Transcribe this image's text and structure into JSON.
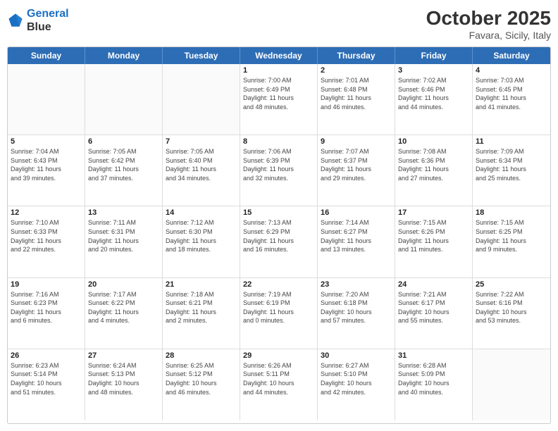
{
  "header": {
    "logo_line1": "General",
    "logo_line2": "Blue",
    "month": "October 2025",
    "location": "Favara, Sicily, Italy"
  },
  "weekdays": [
    "Sunday",
    "Monday",
    "Tuesday",
    "Wednesday",
    "Thursday",
    "Friday",
    "Saturday"
  ],
  "weeks": [
    [
      {
        "day": "",
        "info": ""
      },
      {
        "day": "",
        "info": ""
      },
      {
        "day": "",
        "info": ""
      },
      {
        "day": "1",
        "info": "Sunrise: 7:00 AM\nSunset: 6:49 PM\nDaylight: 11 hours\nand 48 minutes."
      },
      {
        "day": "2",
        "info": "Sunrise: 7:01 AM\nSunset: 6:48 PM\nDaylight: 11 hours\nand 46 minutes."
      },
      {
        "day": "3",
        "info": "Sunrise: 7:02 AM\nSunset: 6:46 PM\nDaylight: 11 hours\nand 44 minutes."
      },
      {
        "day": "4",
        "info": "Sunrise: 7:03 AM\nSunset: 6:45 PM\nDaylight: 11 hours\nand 41 minutes."
      }
    ],
    [
      {
        "day": "5",
        "info": "Sunrise: 7:04 AM\nSunset: 6:43 PM\nDaylight: 11 hours\nand 39 minutes."
      },
      {
        "day": "6",
        "info": "Sunrise: 7:05 AM\nSunset: 6:42 PM\nDaylight: 11 hours\nand 37 minutes."
      },
      {
        "day": "7",
        "info": "Sunrise: 7:05 AM\nSunset: 6:40 PM\nDaylight: 11 hours\nand 34 minutes."
      },
      {
        "day": "8",
        "info": "Sunrise: 7:06 AM\nSunset: 6:39 PM\nDaylight: 11 hours\nand 32 minutes."
      },
      {
        "day": "9",
        "info": "Sunrise: 7:07 AM\nSunset: 6:37 PM\nDaylight: 11 hours\nand 29 minutes."
      },
      {
        "day": "10",
        "info": "Sunrise: 7:08 AM\nSunset: 6:36 PM\nDaylight: 11 hours\nand 27 minutes."
      },
      {
        "day": "11",
        "info": "Sunrise: 7:09 AM\nSunset: 6:34 PM\nDaylight: 11 hours\nand 25 minutes."
      }
    ],
    [
      {
        "day": "12",
        "info": "Sunrise: 7:10 AM\nSunset: 6:33 PM\nDaylight: 11 hours\nand 22 minutes."
      },
      {
        "day": "13",
        "info": "Sunrise: 7:11 AM\nSunset: 6:31 PM\nDaylight: 11 hours\nand 20 minutes."
      },
      {
        "day": "14",
        "info": "Sunrise: 7:12 AM\nSunset: 6:30 PM\nDaylight: 11 hours\nand 18 minutes."
      },
      {
        "day": "15",
        "info": "Sunrise: 7:13 AM\nSunset: 6:29 PM\nDaylight: 11 hours\nand 16 minutes."
      },
      {
        "day": "16",
        "info": "Sunrise: 7:14 AM\nSunset: 6:27 PM\nDaylight: 11 hours\nand 13 minutes."
      },
      {
        "day": "17",
        "info": "Sunrise: 7:15 AM\nSunset: 6:26 PM\nDaylight: 11 hours\nand 11 minutes."
      },
      {
        "day": "18",
        "info": "Sunrise: 7:15 AM\nSunset: 6:25 PM\nDaylight: 11 hours\nand 9 minutes."
      }
    ],
    [
      {
        "day": "19",
        "info": "Sunrise: 7:16 AM\nSunset: 6:23 PM\nDaylight: 11 hours\nand 6 minutes."
      },
      {
        "day": "20",
        "info": "Sunrise: 7:17 AM\nSunset: 6:22 PM\nDaylight: 11 hours\nand 4 minutes."
      },
      {
        "day": "21",
        "info": "Sunrise: 7:18 AM\nSunset: 6:21 PM\nDaylight: 11 hours\nand 2 minutes."
      },
      {
        "day": "22",
        "info": "Sunrise: 7:19 AM\nSunset: 6:19 PM\nDaylight: 11 hours\nand 0 minutes."
      },
      {
        "day": "23",
        "info": "Sunrise: 7:20 AM\nSunset: 6:18 PM\nDaylight: 10 hours\nand 57 minutes."
      },
      {
        "day": "24",
        "info": "Sunrise: 7:21 AM\nSunset: 6:17 PM\nDaylight: 10 hours\nand 55 minutes."
      },
      {
        "day": "25",
        "info": "Sunrise: 7:22 AM\nSunset: 6:16 PM\nDaylight: 10 hours\nand 53 minutes."
      }
    ],
    [
      {
        "day": "26",
        "info": "Sunrise: 6:23 AM\nSunset: 5:14 PM\nDaylight: 10 hours\nand 51 minutes."
      },
      {
        "day": "27",
        "info": "Sunrise: 6:24 AM\nSunset: 5:13 PM\nDaylight: 10 hours\nand 48 minutes."
      },
      {
        "day": "28",
        "info": "Sunrise: 6:25 AM\nSunset: 5:12 PM\nDaylight: 10 hours\nand 46 minutes."
      },
      {
        "day": "29",
        "info": "Sunrise: 6:26 AM\nSunset: 5:11 PM\nDaylight: 10 hours\nand 44 minutes."
      },
      {
        "day": "30",
        "info": "Sunrise: 6:27 AM\nSunset: 5:10 PM\nDaylight: 10 hours\nand 42 minutes."
      },
      {
        "day": "31",
        "info": "Sunrise: 6:28 AM\nSunset: 5:09 PM\nDaylight: 10 hours\nand 40 minutes."
      },
      {
        "day": "",
        "info": ""
      }
    ]
  ]
}
